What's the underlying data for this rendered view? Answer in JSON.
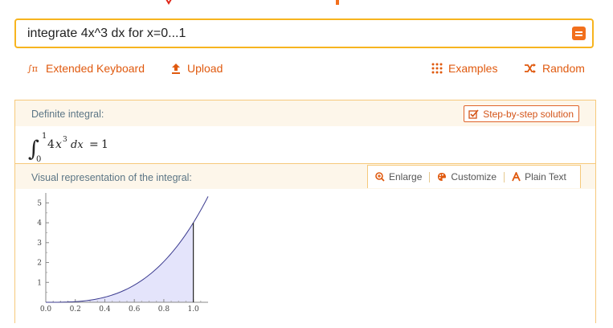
{
  "search": {
    "query": "integrate 4x^3 dx for x=0...1"
  },
  "toolbar": {
    "extended_keyboard": "Extended Keyboard",
    "upload": "Upload",
    "examples": "Examples",
    "random": "Random"
  },
  "pods": {
    "definite_integral": {
      "title": "Definite integral:",
      "step_label": "Step-by-step solution",
      "integrand_coefficient": "4",
      "variable": "x",
      "exponent": "3",
      "lower_limit": "0",
      "upper_limit": "1",
      "differential": "dx",
      "equals": "=",
      "result": "1"
    },
    "visual": {
      "title": "Visual representation of the integral:",
      "actions": {
        "enlarge": "Enlarge",
        "customize": "Customize",
        "plain_text": "Plain Text"
      }
    }
  },
  "chart_data": {
    "type": "area",
    "function": "4x^3",
    "shaded_interval": [
      0,
      1
    ],
    "x_range": [
      0,
      1.1
    ],
    "ylim": [
      0,
      5.5
    ],
    "x_ticks": [
      "0.0",
      "0.2",
      "0.4",
      "0.6",
      "0.8",
      "1.0"
    ],
    "y_ticks": [
      "1",
      "2",
      "3",
      "4",
      "5"
    ],
    "curve_color": "#3b3b8f",
    "fill_color": "#e4e4fb"
  },
  "colors": {
    "accent": "#f26f1c",
    "search_border": "#f7b41f",
    "link": "#e05a0f",
    "pod_border": "#f6c97b",
    "pod_header_bg": "#fdf6ea",
    "pod_title": "#5b7585"
  }
}
